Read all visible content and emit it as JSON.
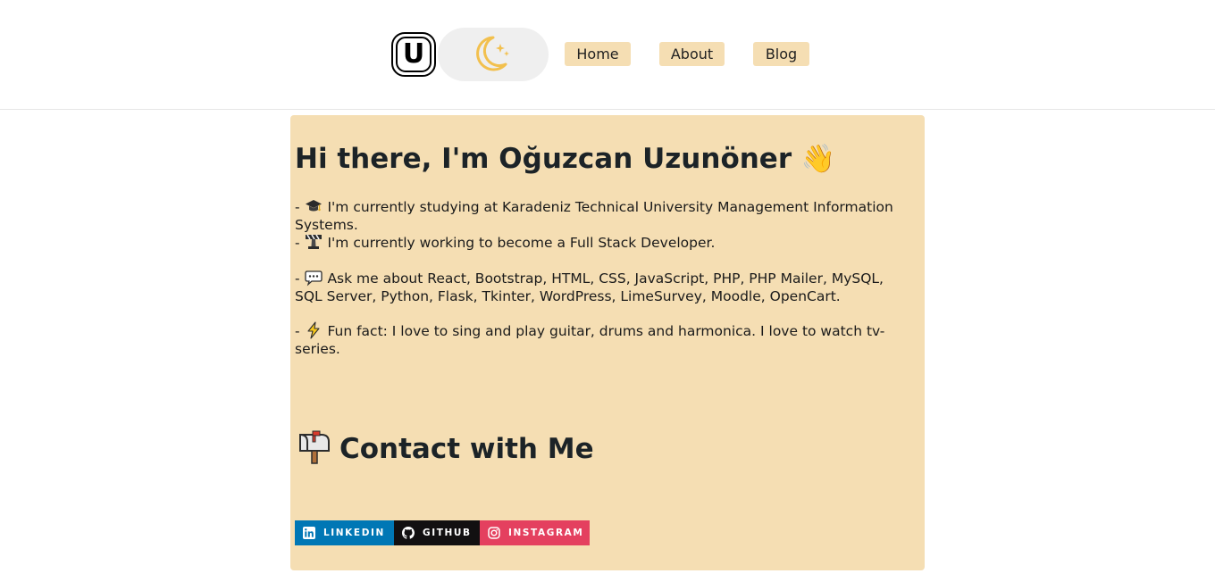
{
  "header": {
    "logo_letter": "U",
    "nav": {
      "home": "Home",
      "about": "About",
      "blog": "Blog"
    }
  },
  "main": {
    "title": "Hi there, I'm Oğuzcan Uzunöner 👋",
    "bullets": [
      {
        "prefix": "- ",
        "icon": "graduation-cap-icon",
        "text": " I'm currently studying at Karadeniz Technical University Management Information Systems."
      },
      {
        "prefix": "- ",
        "icon": "construction-icon",
        "text": " I'm currently working to become a Full Stack Developer."
      },
      {
        "prefix": "- ",
        "icon": "speech-balloon-icon",
        "text": " Ask me about React, Bootstrap, HTML, CSS, JavaScript, PHP, PHP Mailer, MySQL, SQL Server, Python, Flask, Tkinter, WordPress, LimeSurvey, Moodle, OpenCart."
      },
      {
        "prefix": "- ",
        "icon": "lightning-icon",
        "text": " Fun fact: I love to sing and play guitar, drums and harmonica. I love to watch tv-series."
      }
    ],
    "contact_title": "Contact with Me",
    "badges": {
      "linkedin": "LINKEDIN",
      "github": "GITHUB",
      "instagram": "INSTAGRAM"
    }
  },
  "colors": {
    "card_bg": "#f5deb3",
    "nav_bg": "#f5deb3",
    "toggle_bg": "#efefef",
    "moon": "#f2c04e",
    "linkedin": "#0077b5",
    "github": "#121011",
    "instagram": "#e4405f"
  }
}
